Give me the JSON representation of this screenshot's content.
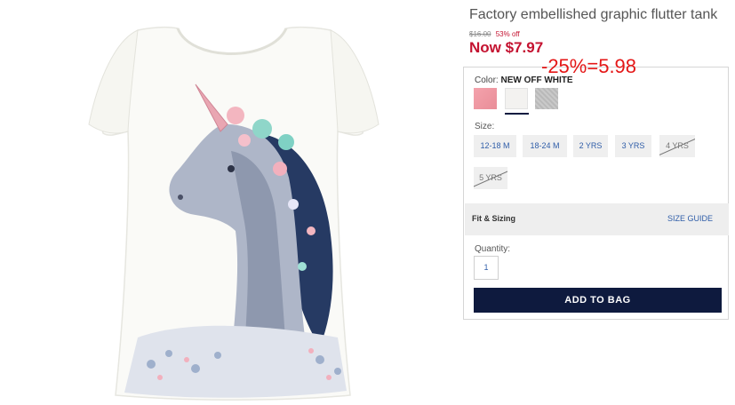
{
  "product": {
    "title": "Factory embellished graphic flutter tank",
    "original_price": "$16.00",
    "discount_text": "53% off",
    "now_price": "Now $7.97"
  },
  "annotation": "-25%=5.98",
  "options": {
    "color_label": "Color:",
    "color_value": "NEW OFF WHITE",
    "swatches": [
      {
        "name": "pink",
        "color": "#ef98a3"
      },
      {
        "name": "off-white",
        "color": "#f3f2f0",
        "selected": true
      },
      {
        "name": "heather-gray",
        "color": "#c2c2c2"
      }
    ],
    "size_label": "Size:",
    "sizes": [
      "12-18 M",
      "18-24 M",
      "2 YRS",
      "3 YRS",
      "4 YRS",
      "5 YRS"
    ],
    "unavailable_sizes": [
      "4 YRS",
      "5 YRS"
    ]
  },
  "fit": {
    "label": "Fit & Sizing",
    "guide": "SIZE GUIDE"
  },
  "quantity": {
    "label": "Quantity:",
    "value": "1"
  },
  "add_to_bag": "ADD TO BAG",
  "colors": {
    "sale_red": "#c41230",
    "annotation_red": "#e41616",
    "navy": "#0e1a3e",
    "link_blue": "#2f5da8"
  }
}
